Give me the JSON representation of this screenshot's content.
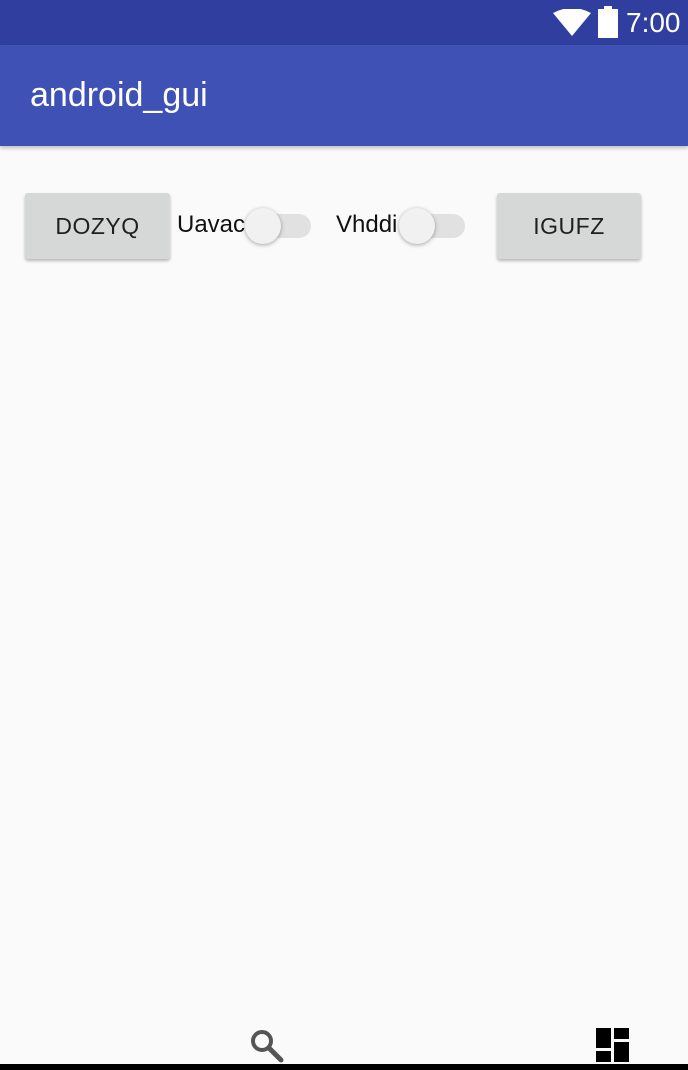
{
  "status_bar": {
    "time": "7:00",
    "icons": [
      "wifi-icon",
      "battery-icon"
    ],
    "color": "#303f9f"
  },
  "app_bar": {
    "title": "android_gui",
    "color": "#3f51b5"
  },
  "controls": {
    "button_left": "DOZYQ",
    "switch_1": {
      "label": "Uavac",
      "checked": false
    },
    "switch_2": {
      "label": "Vhddi",
      "checked": false
    },
    "button_right": "IGUFZ"
  },
  "bottom_bar": {
    "icons": [
      "search-icon",
      "dashboard-icon"
    ]
  }
}
